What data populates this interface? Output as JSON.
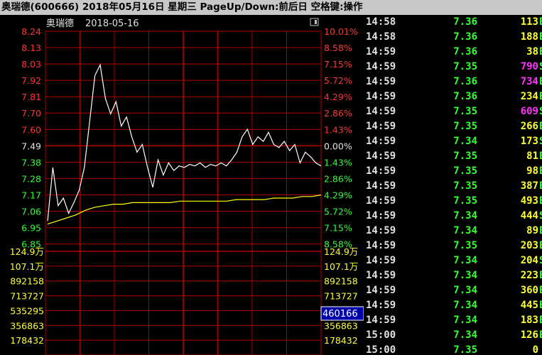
{
  "window": {
    "title": "奥瑞德(600666) 2018年05月16日 星期三 PageUp/Down:前后日 空格键:操作"
  },
  "header": {
    "stock_name": "奥瑞德",
    "date": "2018-05-16",
    "menu_icon": "window-icon"
  },
  "price_axis": {
    "left_labels": [
      "8.24",
      "8.13",
      "8.03",
      "7.92",
      "7.81",
      "7.70",
      "7.60",
      "7.49",
      "7.38",
      "7.28",
      "7.17",
      "7.06",
      "6.95",
      "6.85"
    ],
    "right_labels": [
      "10.01%",
      "8.58%",
      "7.15%",
      "5.72%",
      "4.29%",
      "2.86%",
      "1.43%",
      "0.00%",
      "1.43%",
      "2.86%",
      "4.29%",
      "5.72%",
      "7.15%",
      "8.58%"
    ],
    "reference_price": "7.49"
  },
  "volume_axis": {
    "left_labels": [
      "124.9万",
      "107.1万",
      "892158",
      "713727",
      "535295",
      "356863",
      "178432"
    ],
    "right_labels": [
      "124.9万",
      "107.1万",
      "892158",
      "713727",
      "",
      "356863",
      "178432"
    ],
    "cursor_value": "460166"
  },
  "chart_data": {
    "type": "line",
    "series": [],
    "x_range": [
      "09:30",
      "15:00"
    ],
    "ylim": [
      6.85,
      8.24
    ],
    "intraday_price_approx": [
      7.0,
      7.35,
      7.1,
      7.15,
      7.05,
      7.12,
      7.2,
      7.35,
      7.65,
      7.95,
      8.02,
      7.8,
      7.7,
      7.78,
      7.62,
      7.68,
      7.55,
      7.45,
      7.5,
      7.35,
      7.22,
      7.4,
      7.3,
      7.38,
      7.33,
      7.36,
      7.35,
      7.37,
      7.36,
      7.38,
      7.35,
      7.37,
      7.36,
      7.38,
      7.36,
      7.4,
      7.45,
      7.55,
      7.6,
      7.5,
      7.55,
      7.52,
      7.58,
      7.5,
      7.48,
      7.52,
      7.46,
      7.5,
      7.38,
      7.45,
      7.42,
      7.38,
      7.36
    ],
    "average_price_approx": [
      6.98,
      7.0,
      7.02,
      7.04,
      7.07,
      7.09,
      7.1,
      7.11,
      7.11,
      7.12,
      7.12,
      7.12,
      7.12,
      7.12,
      7.13,
      7.13,
      7.13,
      7.13,
      7.13,
      7.13,
      7.14,
      7.14,
      7.14,
      7.14,
      7.15,
      7.15,
      7.15,
      7.16,
      7.16,
      7.17
    ],
    "grid": true
  },
  "ticks": [
    {
      "time": "14:58",
      "price": "7.36",
      "vol": "113",
      "mark": "E",
      "vol_color": "#ffff33"
    },
    {
      "time": "14:58",
      "price": "7.36",
      "vol": "188",
      "mark": "E",
      "vol_color": "#ffff33"
    },
    {
      "time": "14:59",
      "price": "7.36",
      "vol": "38",
      "mark": "E",
      "vol_color": "#ffff33"
    },
    {
      "time": "14:59",
      "price": "7.35",
      "vol": "790",
      "mark": "S",
      "vol_color": "#ff33ff"
    },
    {
      "time": "14:59",
      "price": "7.36",
      "vol": "734",
      "mark": "E",
      "vol_color": "#ff33ff"
    },
    {
      "time": "14:59",
      "price": "7.36",
      "vol": "234",
      "mark": "E",
      "vol_color": "#ffff33"
    },
    {
      "time": "14:59",
      "price": "7.35",
      "vol": "609",
      "mark": "S",
      "vol_color": "#ff33ff"
    },
    {
      "time": "14:59",
      "price": "7.35",
      "vol": "266",
      "mark": "E",
      "vol_color": "#ffff33"
    },
    {
      "time": "14:59",
      "price": "7.34",
      "vol": "173",
      "mark": "S",
      "vol_color": "#ffff33"
    },
    {
      "time": "14:59",
      "price": "7.35",
      "vol": "81",
      "mark": "E",
      "vol_color": "#ffff33"
    },
    {
      "time": "14:59",
      "price": "7.35",
      "vol": "98",
      "mark": "E",
      "vol_color": "#ffff33"
    },
    {
      "time": "14:59",
      "price": "7.35",
      "vol": "387",
      "mark": "E",
      "vol_color": "#ffff33"
    },
    {
      "time": "14:59",
      "price": "7.35",
      "vol": "493",
      "mark": "E",
      "vol_color": "#ffff33"
    },
    {
      "time": "14:59",
      "price": "7.34",
      "vol": "444",
      "mark": "S",
      "vol_color": "#ffff33"
    },
    {
      "time": "14:59",
      "price": "7.34",
      "vol": "89",
      "mark": "E",
      "vol_color": "#ffff33"
    },
    {
      "time": "14:59",
      "price": "7.35",
      "vol": "203",
      "mark": "E",
      "vol_color": "#ffff33"
    },
    {
      "time": "14:59",
      "price": "7.34",
      "vol": "204",
      "mark": "S",
      "vol_color": "#ffff33"
    },
    {
      "time": "14:59",
      "price": "7.34",
      "vol": "223",
      "mark": "E",
      "vol_color": "#ffff33"
    },
    {
      "time": "14:59",
      "price": "7.34",
      "vol": "360",
      "mark": "E",
      "vol_color": "#ffff33"
    },
    {
      "time": "14:59",
      "price": "7.34",
      "vol": "445",
      "mark": "E",
      "vol_color": "#ffff33"
    },
    {
      "time": "14:59",
      "price": "7.34",
      "vol": "183",
      "mark": "E",
      "vol_color": "#ffff33"
    },
    {
      "time": "15:00",
      "price": "7.34",
      "vol": "126",
      "mark": "E",
      "vol_color": "#ffff33"
    },
    {
      "time": "15:00",
      "price": "7.35",
      "vol": "0",
      "mark": "",
      "vol_color": "#ffff33"
    }
  ],
  "colors": {
    "grid": "#b00000",
    "axis_text_up": "#ff3333",
    "axis_text_down": "#33ff33",
    "price_line": "#ffffff",
    "avg_line": "#ffff00",
    "neutral_text": "#e0e0e0",
    "title_bar": "#c8c8c8",
    "cursor_box": "#0000aa"
  }
}
